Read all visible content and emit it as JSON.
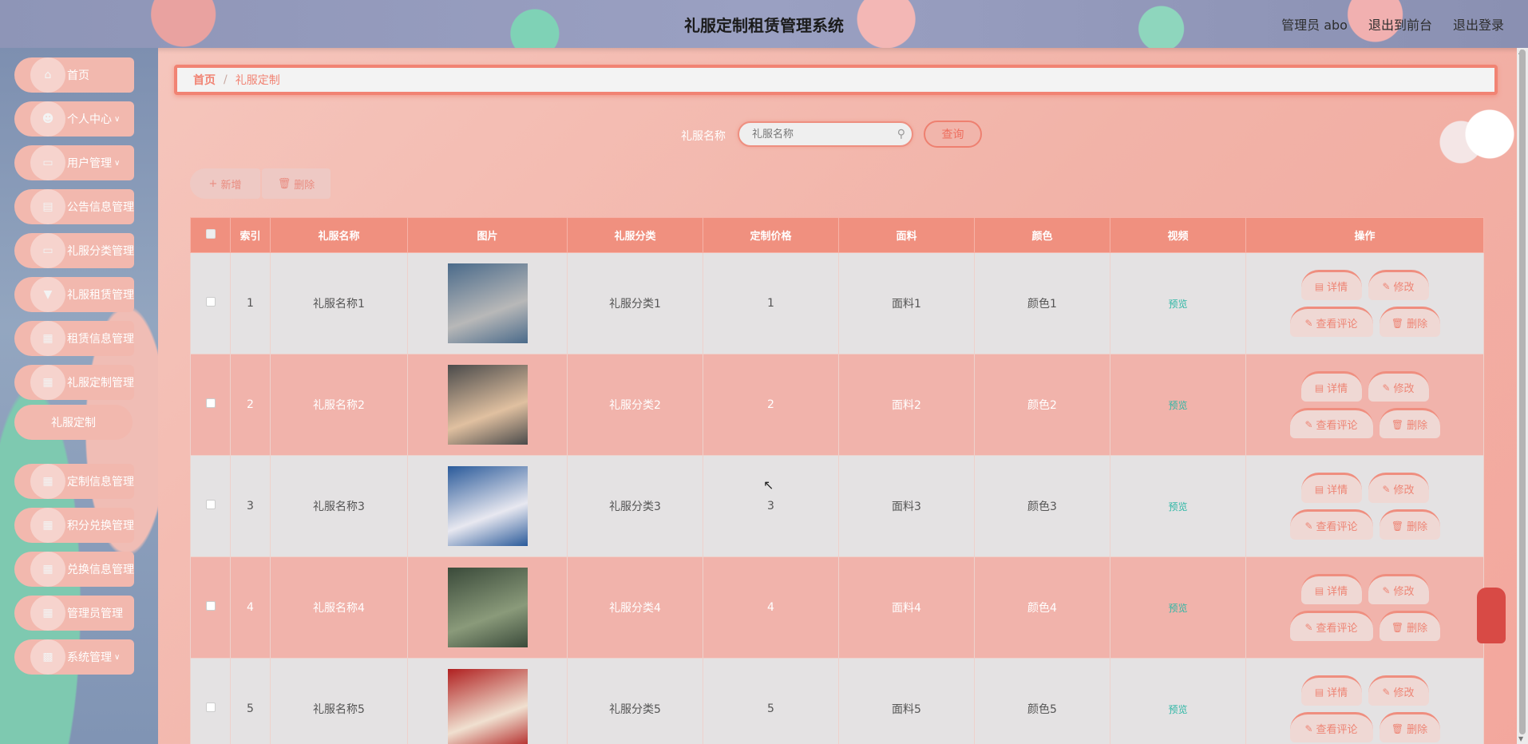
{
  "header": {
    "title": "礼服定制租赁管理系统",
    "admin_label": "管理员 abo",
    "back_front": "退出到前台",
    "logout": "退出登录"
  },
  "sidebar": {
    "items": [
      {
        "label": "首页",
        "icon": "home-icon",
        "has_chevron": false
      },
      {
        "label": "个人中心",
        "icon": "person-icon",
        "has_chevron": true
      },
      {
        "label": "用户管理",
        "icon": "monitor-icon",
        "has_chevron": true
      },
      {
        "label": "公告信息管理",
        "icon": "clipboard-icon",
        "has_chevron": false
      },
      {
        "label": "礼服分类管理",
        "icon": "monitor-icon",
        "has_chevron": false
      },
      {
        "label": "礼服租赁管理",
        "icon": "pin-icon",
        "has_chevron": false
      },
      {
        "label": "租赁信息管理",
        "icon": "grid-icon",
        "has_chevron": false
      },
      {
        "label": "礼服定制管理",
        "icon": "grid-icon",
        "has_chevron": false
      },
      {
        "label": "定制信息管理",
        "icon": "grid-icon",
        "has_chevron": false
      },
      {
        "label": "积分兑换管理",
        "icon": "grid-icon",
        "has_chevron": false
      },
      {
        "label": "兑换信息管理",
        "icon": "grid-icon",
        "has_chevron": false
      },
      {
        "label": "管理员管理",
        "icon": "grid-icon",
        "has_chevron": false
      },
      {
        "label": "系统管理",
        "icon": "briefcase-icon",
        "has_chevron": true
      }
    ],
    "submenu_active": "礼服定制"
  },
  "breadcrumb": {
    "home": "首页",
    "separator": "/",
    "current": "礼服定制"
  },
  "search": {
    "label": "礼服名称",
    "placeholder": "礼服名称",
    "button": "查询"
  },
  "actions": {
    "add": "新增",
    "delete": "删除"
  },
  "table": {
    "columns": [
      "索引",
      "礼服名称",
      "图片",
      "礼服分类",
      "定制价格",
      "面料",
      "颜色",
      "视频",
      "操作"
    ],
    "rows": [
      {
        "index": "1",
        "name": "礼服名称1",
        "category": "礼服分类1",
        "price": "1",
        "fabric": "面料1",
        "color": "颜色1",
        "video": "预览"
      },
      {
        "index": "2",
        "name": "礼服名称2",
        "category": "礼服分类2",
        "price": "2",
        "fabric": "面料2",
        "color": "颜色2",
        "video": "预览"
      },
      {
        "index": "3",
        "name": "礼服名称3",
        "category": "礼服分类3",
        "price": "3",
        "fabric": "面料3",
        "color": "颜色3",
        "video": "预览"
      },
      {
        "index": "4",
        "name": "礼服名称4",
        "category": "礼服分类4",
        "price": "4",
        "fabric": "面料4",
        "color": "颜色4",
        "video": "预览"
      },
      {
        "index": "5",
        "name": "礼服名称5",
        "category": "礼服分类5",
        "price": "5",
        "fabric": "面料5",
        "color": "颜色5",
        "video": "预览"
      }
    ],
    "row_actions": {
      "detail": "详情",
      "edit": "修改",
      "review": "查看评论",
      "delete": "删除"
    }
  },
  "colors": {
    "accent": "#f0907f",
    "accent_dark": "#ee8070",
    "row_odd": "#e4e2e3",
    "row_even": "#f1b3ab",
    "video_link": "#2eb7a5"
  }
}
